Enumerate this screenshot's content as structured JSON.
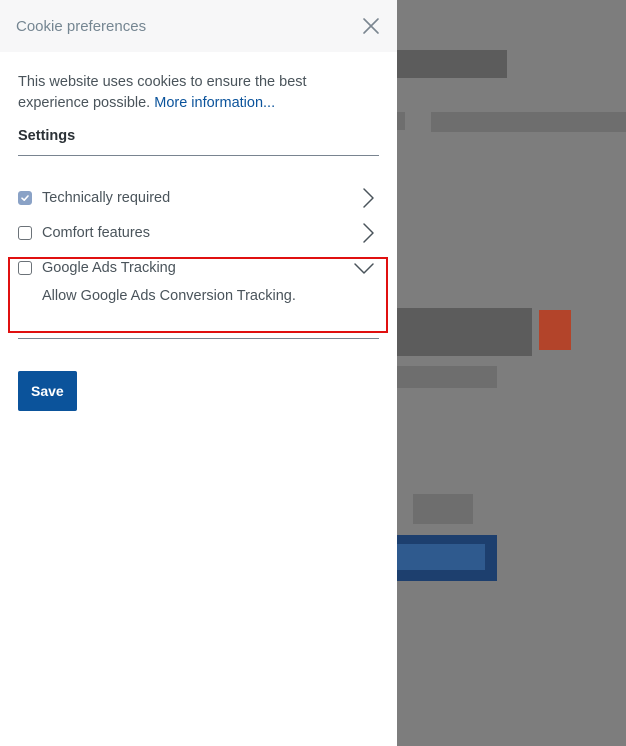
{
  "panel": {
    "title": "Cookie preferences",
    "close_icon": "close-icon"
  },
  "intro": {
    "text": "This website uses cookies to ensure the best experience possible.",
    "link": "More information..."
  },
  "settings": {
    "title": "Settings",
    "options": [
      {
        "label": "Technically required",
        "checked": true,
        "icon": "chevron-right-icon"
      },
      {
        "label": "Comfort features",
        "checked": false,
        "icon": "chevron-right-icon"
      },
      {
        "label": "Google Ads Tracking",
        "checked": false,
        "icon": "chevron-down-icon",
        "expanded": true,
        "description": "Allow Google Ads Conversion Tracking."
      }
    ]
  },
  "save_label": "Save",
  "colors": {
    "accent": "#0b539b",
    "highlight": "#e01010",
    "checkbox_checked": "#8aa2c6"
  }
}
